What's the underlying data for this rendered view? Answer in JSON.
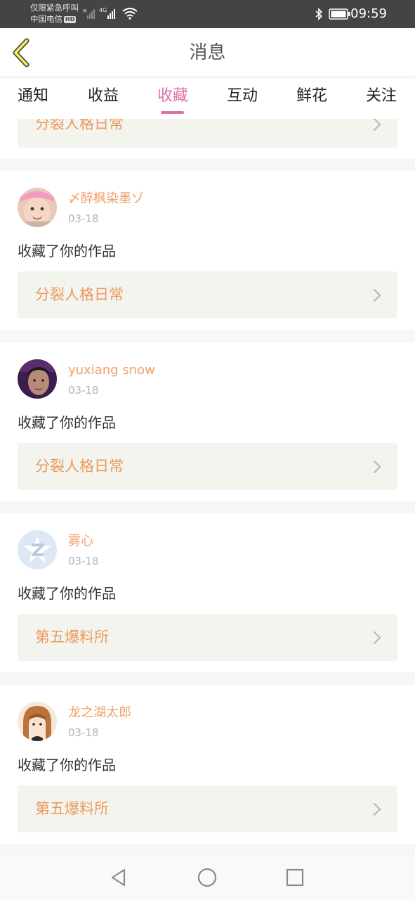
{
  "status_bar": {
    "line1": "仅限紧急呼叫",
    "line2": "中国电信",
    "hd_badge": "HD",
    "network": "4G",
    "time": "09:59"
  },
  "header": {
    "title": "消息",
    "back_icon": "chevron-left-icon"
  },
  "tabs": [
    {
      "label": "通知",
      "active": false
    },
    {
      "label": "收益",
      "active": false
    },
    {
      "label": "收藏",
      "active": true
    },
    {
      "label": "互动",
      "active": false
    },
    {
      "label": "鲜花",
      "active": false
    },
    {
      "label": "关注",
      "active": false
    }
  ],
  "partial_card": {
    "work_title": "分裂人格日常"
  },
  "messages": [
    {
      "user": "〆醉枫染墨ゾ",
      "date": "03-18",
      "action": "收藏了你的作品",
      "work_title": "分裂人格日常",
      "avatar": "child-photo-avatar"
    },
    {
      "user": "yuxiang snow",
      "date": "03-18",
      "action": "收藏了你的作品",
      "work_title": "分裂人格日常",
      "avatar": "man-photo-avatar"
    },
    {
      "user": "雾心",
      "date": "03-18",
      "action": "收藏了你的作品",
      "work_title": "第五爆料所",
      "avatar": "default-z-avatar"
    },
    {
      "user": "龙之湖太郎",
      "date": "03-18",
      "action": "收藏了你的作品",
      "work_title": "第五爆料所",
      "avatar": "anime-girl-avatar"
    }
  ],
  "colors": {
    "accent": "#e170a6",
    "username": "#f0a06a",
    "work_title": "#eb9a5e",
    "work_bg": "#f4f4ef",
    "status_bar": "#444444"
  }
}
